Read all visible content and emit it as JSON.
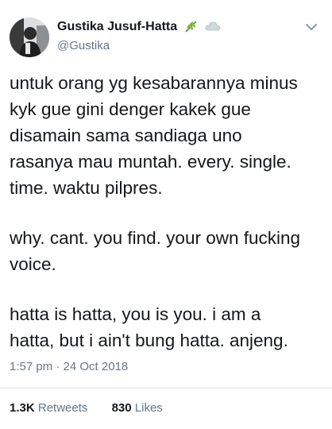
{
  "user": {
    "display_name": "Gustika Jusuf-Hatta",
    "handle": "@Gustika",
    "badge_icons": [
      "herb-icon",
      "cloud-icon"
    ]
  },
  "tweet": {
    "lines": [
      "untuk orang yg kesabarannya minus",
      "kyk gue gini denger kakek gue",
      "disamain sama sandiaga uno",
      "rasanya mau muntah. every. single.",
      "time. waktu pilpres.",
      "why. cant. you find. your own fucking",
      "voice.",
      "hatta is hatta, you is you. i am a",
      "hatta, but i ain't bung hatta. anjeng."
    ],
    "timestamp": "1:57 pm · 24 Oct 2018"
  },
  "stats": {
    "retweets_count": "1.3K",
    "retweets_label": "Retweets",
    "likes_count": "830",
    "likes_label": "Likes"
  },
  "colors": {
    "text": "#14171a",
    "muted": "#657786",
    "divider": "#e1e8ed"
  }
}
